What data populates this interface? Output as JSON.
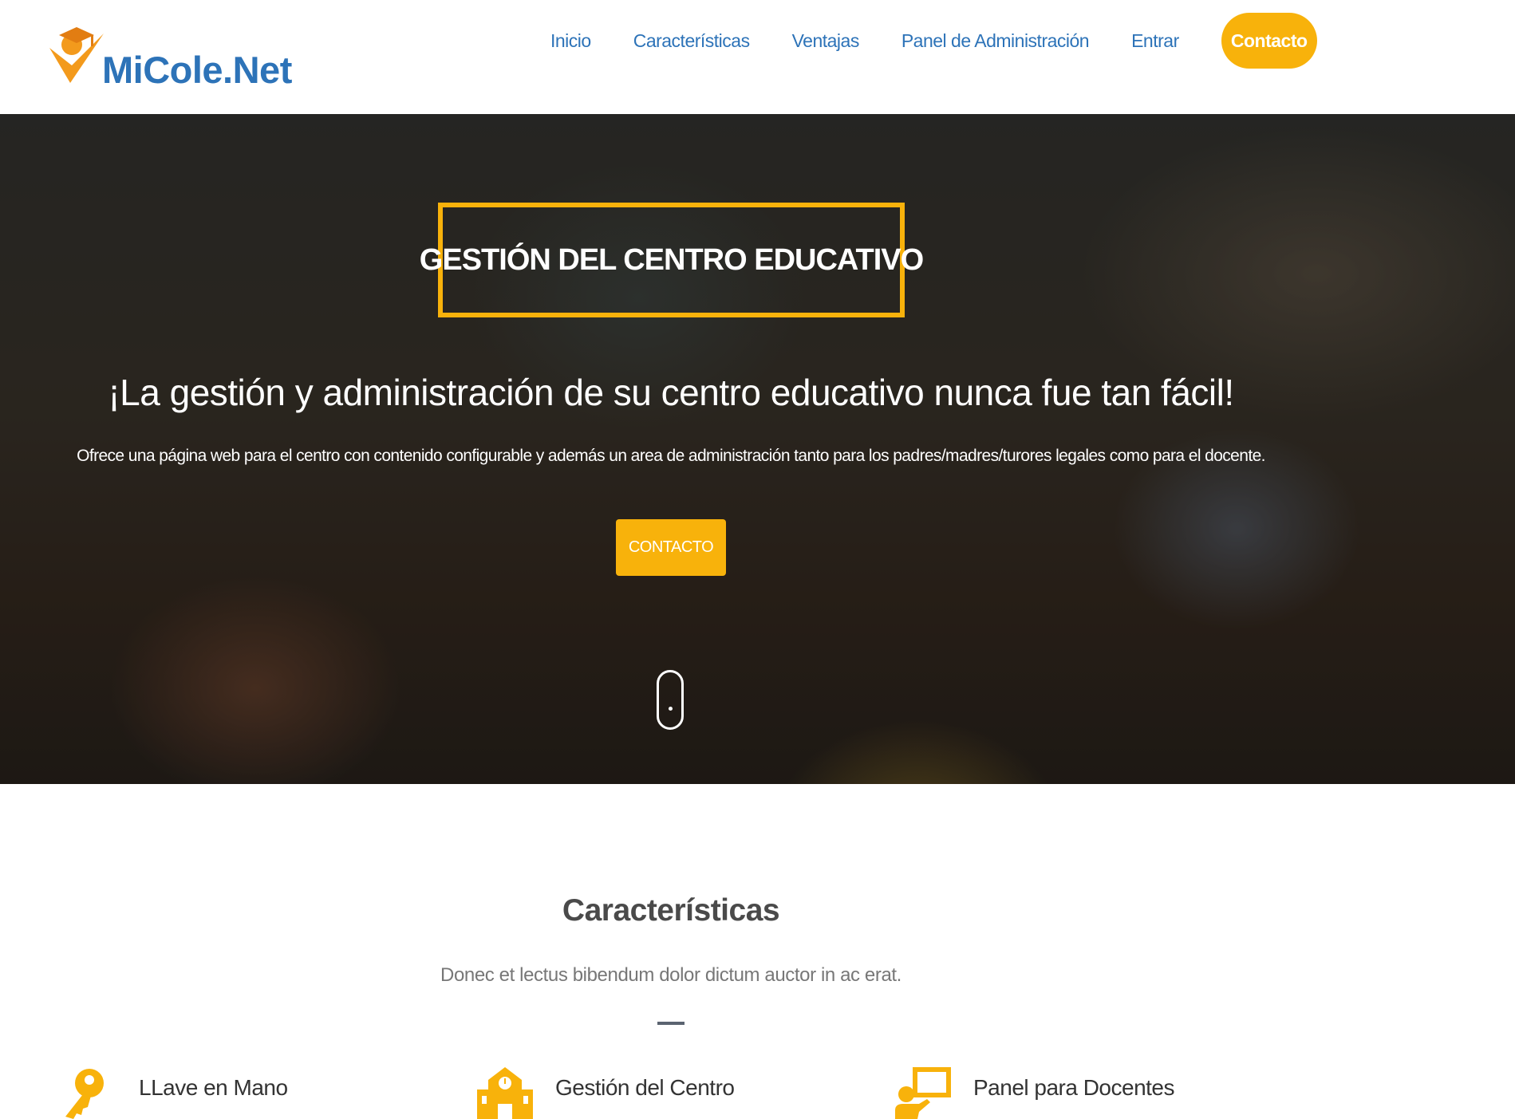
{
  "brand": {
    "name": "MiCole.Net",
    "primary_color": "#2d73b8",
    "accent_color": "#f8b20b"
  },
  "nav": {
    "items": [
      "Inicio",
      "Características",
      "Ventajas",
      "Panel de Administración",
      "Entrar"
    ],
    "cta": "Contacto"
  },
  "hero": {
    "boxed_title": "GESTIÓN DEL CENTRO EDUCATIVO",
    "headline": "¡La gestión y administración de su centro educativo nunca fue tan fácil!",
    "subline": "Ofrece una página web para el centro con contenido configurable y además un area de administración tanto para los padres/madres/turores legales como para el docente.",
    "button": "CONTACTO",
    "scroll_icon": "mouse-scroll-icon"
  },
  "features": {
    "title": "Características",
    "subtitle": "Donec et lectus bibendum dolor dictum auctor in ac erat.",
    "items": [
      {
        "icon": "key-icon",
        "title": "LLave en Mano"
      },
      {
        "icon": "school-building-icon",
        "title": "Gestión del Centro"
      },
      {
        "icon": "teacher-board-icon",
        "title": "Panel para Docentes"
      }
    ]
  }
}
